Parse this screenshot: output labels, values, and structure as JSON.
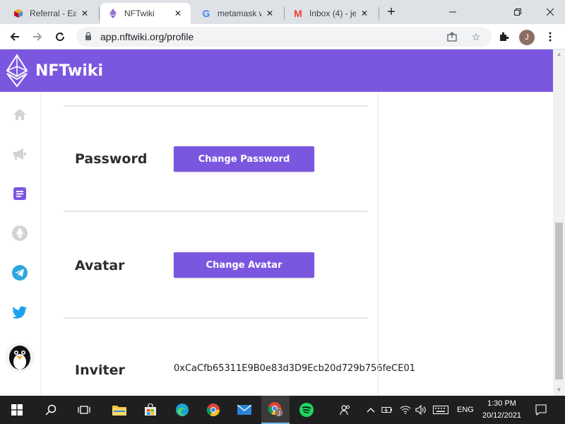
{
  "browser": {
    "tabs": [
      {
        "title": "Referral - Ea",
        "favicon": "cube-icon",
        "active": false
      },
      {
        "title": "NFTwiki",
        "favicon": "ethereum-icon",
        "active": true
      },
      {
        "title": "metamask w",
        "favicon": "google-icon",
        "active": false
      },
      {
        "title": "Inbox (4) - je",
        "favicon": "gmail-icon",
        "active": false
      }
    ],
    "new_tab_label": "+",
    "address": "app.nftwiki.org/profile",
    "profile_initial": "J"
  },
  "app": {
    "name": "NFTwiki",
    "brand_color": "#7b57e0"
  },
  "sidebar": {
    "items": [
      {
        "name": "home-icon"
      },
      {
        "name": "megaphone-icon"
      },
      {
        "name": "document-icon"
      },
      {
        "name": "ethereum-icon"
      },
      {
        "name": "telegram-icon"
      },
      {
        "name": "twitter-icon"
      },
      {
        "name": "penguin-avatar-icon"
      }
    ]
  },
  "profile": {
    "password_label": "Password",
    "password_button": "Change Password",
    "avatar_label": "Avatar",
    "avatar_button": "Change Avatar",
    "inviter_label": "Inviter",
    "inviter_value": "0xCaCfb65311E9B0e83d3D9Ecb20d729b756feCE01"
  },
  "taskbar": {
    "language": "ENG",
    "time": "1:30 PM",
    "date": "20/12/2021",
    "chrome_badge": "J"
  }
}
